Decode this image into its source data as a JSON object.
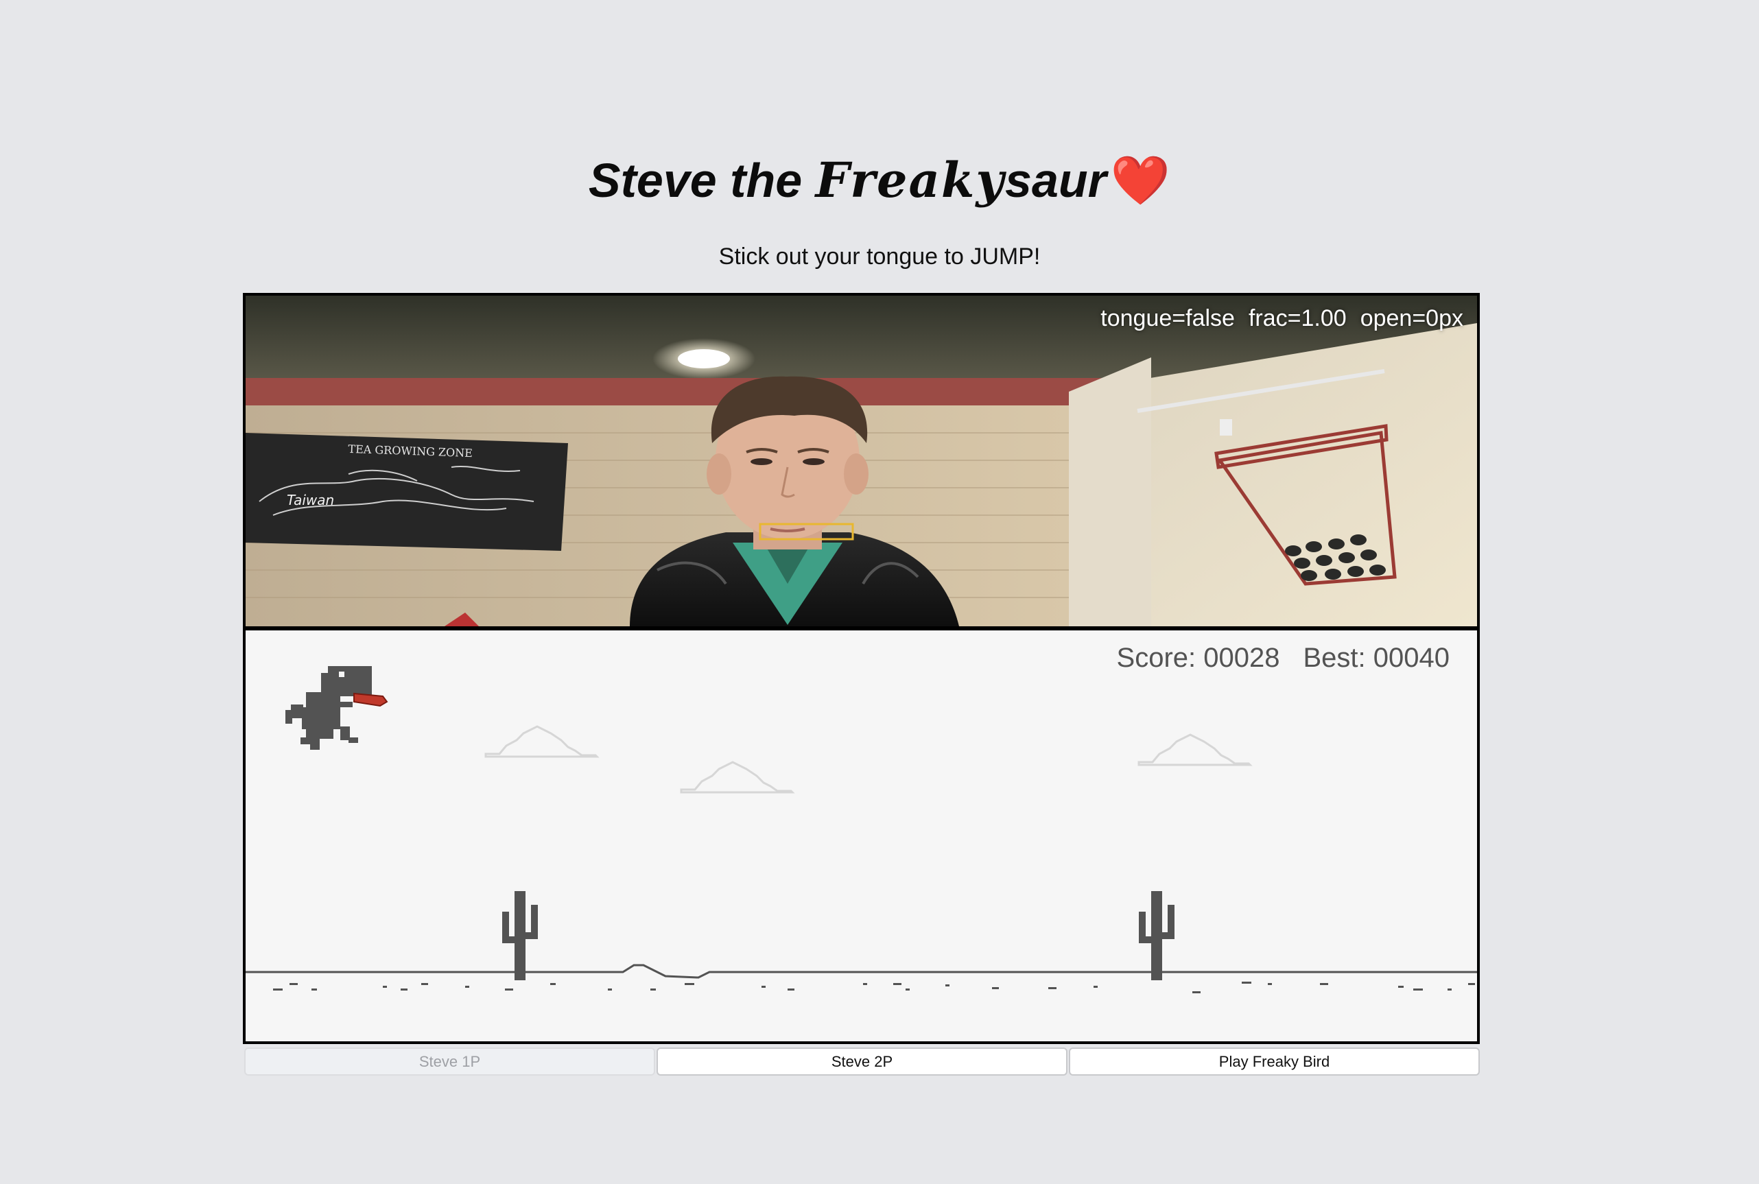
{
  "header": {
    "title_part1": "Steve the ",
    "title_part2": "Freaky",
    "title_part3": "saur",
    "title_emoji": "❤️",
    "subtitle": "Stick out your tongue to JUMP!"
  },
  "camera": {
    "tongue": "tongue=false",
    "frac": "frac=1.00",
    "open": "open=0px",
    "wall_sign": "TEA GROWING ZONE",
    "map_label": "Taiwan"
  },
  "game": {
    "score": "Score: 00028",
    "best": "Best: 00040",
    "colors": {
      "ink": "#535353",
      "tongue": "#c0392b",
      "cloud": "#d9d9d9"
    }
  },
  "modes": {
    "buttons": [
      "Steve 1P",
      "Steve 2P",
      "Play Freaky Bird"
    ],
    "active": "Steve 1P"
  }
}
